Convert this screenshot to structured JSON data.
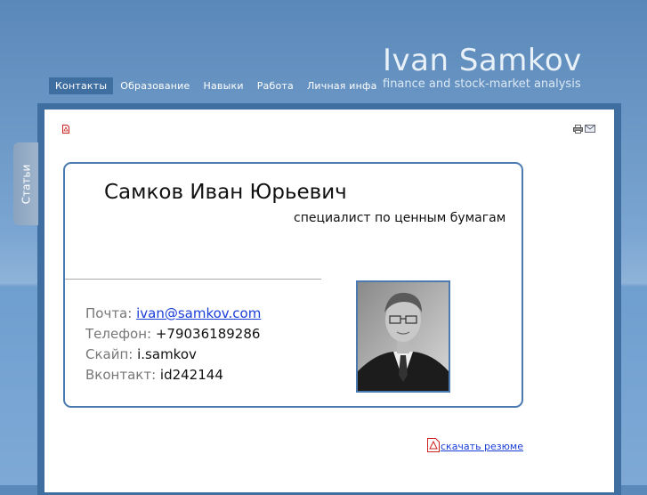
{
  "nav": {
    "items": [
      {
        "label": "Контакты",
        "active": true
      },
      {
        "label": "Образование"
      },
      {
        "label": "Навыки"
      },
      {
        "label": "Работа"
      },
      {
        "label": "Личная инфа"
      }
    ]
  },
  "brand": {
    "title": "Ivan Samkov",
    "subtitle": "finance and stock-market analysis"
  },
  "side_tab": {
    "label": "Статьи"
  },
  "card": {
    "name": "Самков Иван Юрьевич",
    "position": "специалист по ценным бумагам",
    "contacts": [
      {
        "label": "Почта:",
        "value": "ivan@samkov.com",
        "link": true
      },
      {
        "label": "Телефон:",
        "value": "+79036189286"
      },
      {
        "label": "Скайп:",
        "value": "i.samkov"
      },
      {
        "label": "Вконтакт:",
        "value": "id242144"
      }
    ]
  },
  "download": {
    "label": "скачать резюме"
  },
  "icons": {
    "pdf": "pdf-icon",
    "print": "print-icon",
    "email": "email-icon"
  },
  "colors": {
    "accent": "#3f6ea1",
    "link": "#1a3ed8",
    "card_border": "#4a7ab0"
  }
}
